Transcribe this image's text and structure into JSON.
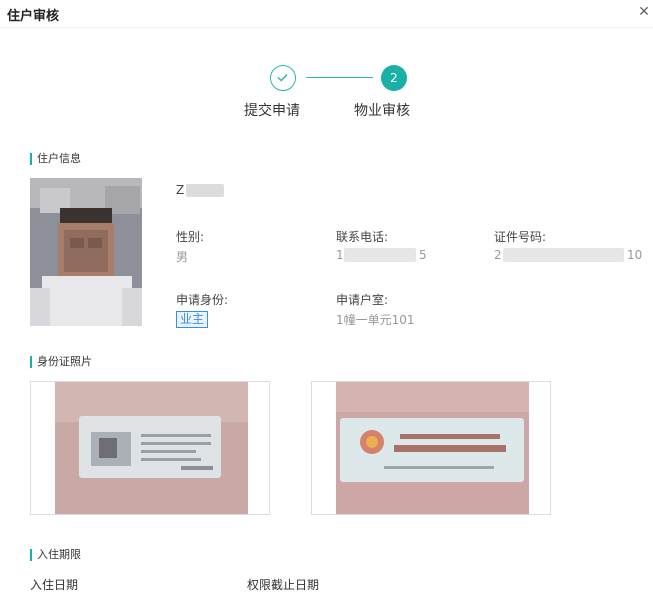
{
  "header": {
    "title": "住户审核",
    "close": "✕"
  },
  "steps": [
    {
      "label": "提交申请",
      "status": "done"
    },
    {
      "label": "物业审核",
      "number": "2",
      "status": "current"
    }
  ],
  "sections": {
    "resident_info": "住户信息",
    "id_photos": "身份证照片",
    "residence_period": "入住期限"
  },
  "resident": {
    "name": "Z",
    "gender_label": "性别:",
    "gender": "男",
    "phone_label": "联系电话:",
    "phone": "1",
    "phone_tail": "5",
    "id_label": "证件号码:",
    "id_number": "2",
    "id_tail": "10",
    "role_label": "申请身份:",
    "role": "业主",
    "room_label": "申请户室:",
    "room": "1幢一单元101"
  },
  "period": {
    "start_label": "入住日期",
    "end_label": "权限截止日期"
  },
  "colors": {
    "accent": "#1ab0a5",
    "tag": "#3a8ee6"
  }
}
